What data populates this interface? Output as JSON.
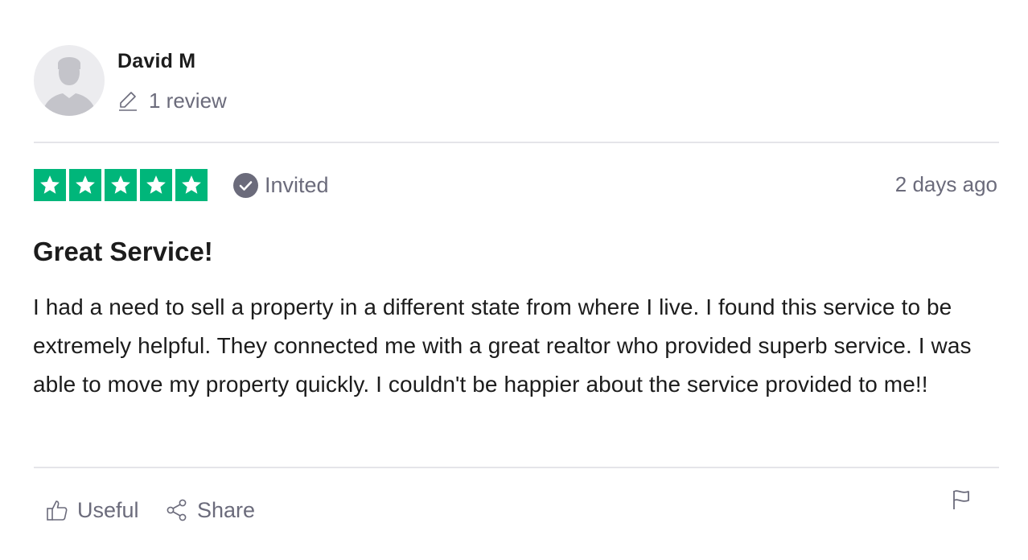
{
  "reviewer": {
    "name": "David M",
    "review_count": "1 review",
    "avatar_icon": "user-silhouette-icon"
  },
  "rating": {
    "stars": 5,
    "max_stars": 5,
    "star_color": "#00b67a"
  },
  "verification": {
    "label": "Invited",
    "icon": "check-circle-icon"
  },
  "date": "2 days ago",
  "review": {
    "title": "Great Service!",
    "body": "I had a need to sell a property in a different state from where I live. I found this service to be extremely helpful. They connected me with a great realtor who provided superb service. I was able to move my property quickly. I couldn't be happier about the service provided to me!!"
  },
  "actions": {
    "useful_label": "Useful",
    "share_label": "Share",
    "useful_icon": "thumbs-up-icon",
    "share_icon": "share-icon",
    "flag_icon": "flag-icon"
  },
  "colors": {
    "text_primary": "#1c1c1c",
    "text_secondary": "#6b6b7b",
    "divider": "#e5e5e9",
    "avatar_bg": "#ececef"
  }
}
